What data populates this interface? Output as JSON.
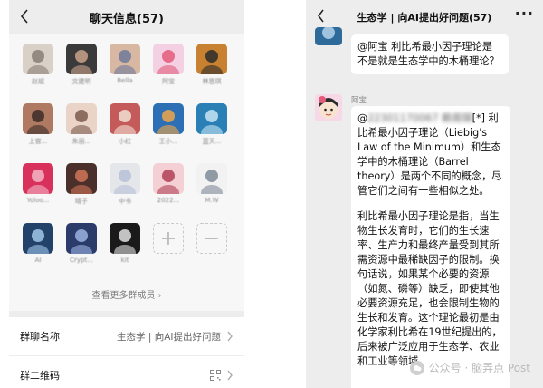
{
  "left": {
    "title": "聊天信息(57)",
    "members": [
      {
        "name": "赵斌",
        "color": "#d9d0c7",
        "accent": "#8a7f75"
      },
      {
        "name": "文建明",
        "color": "#3a3a3a",
        "accent": "#c9a38a"
      },
      {
        "name": "Bella",
        "color": "#d8b7a3",
        "accent": "#6c7a9a"
      },
      {
        "name": "阿宝",
        "color": "#f3d1e3",
        "accent": "#e35a7a"
      },
      {
        "name": "林思琪",
        "color": "#c88130",
        "accent": "#2b2b2b"
      },
      {
        "name": "上官...",
        "color": "#b07a62",
        "accent": "#3b2d28"
      },
      {
        "name": "朱丽...",
        "color": "#e9d4c7",
        "accent": "#7b5a4c"
      },
      {
        "name": "小红",
        "color": "#c55a5a",
        "accent": "#f1e0d4"
      },
      {
        "name": "王小...",
        "color": "#2d6fb4",
        "accent": "#f0a648"
      },
      {
        "name": "蓝天...",
        "color": "#2a7fb5",
        "accent": "#c7e4f5"
      },
      {
        "name": "Yoloo...",
        "color": "#d8315b",
        "accent": "#f3b5c6"
      },
      {
        "name": "晴子",
        "color": "#4b2f2a",
        "accent": "#d07658"
      },
      {
        "name": "中书",
        "color": "#e4e6ea",
        "accent": "#b7c0d6"
      },
      {
        "name": "2022...",
        "color": "#f4d0d5",
        "accent": "#b03f55"
      },
      {
        "name": "M.W",
        "color": "#f2f2f2",
        "accent": "#7f8a99"
      },
      {
        "name": "AI",
        "color": "#234269",
        "accent": "#9fc5ea"
      },
      {
        "name": "Crypt...",
        "color": "#2b3c6b",
        "accent": "#9bb3e0"
      },
      {
        "name": "kit",
        "color": "#1a1a1a",
        "accent": "#e0e0e0"
      }
    ],
    "add_symbol": "+",
    "remove_symbol": "−",
    "more_label": "查看更多群成员",
    "group_name_label": "群聊名称",
    "group_name_value": "生态学 | 向AI提出好问题",
    "qr_label": "群二维码"
  },
  "right": {
    "title": "生态学 | 向AI提出好问题(57)",
    "menu": "···",
    "question": "@阿宝  利比希最小因子理论是不是就是生态学中的木桶理论？",
    "sender_name": "阿宝",
    "reply_mention": "@",
    "reply_blurred": "22301170067 赖南锦",
    "reply_p1_rest": "[*] 利比希最小因子理论（Liebig's Law of the Minimum）和生态学中的木桶理论（Barrel theory）是两个不同的概念，尽管它们之间有一些相似之处。",
    "reply_p2": "利比希最小因子理论是指，当生物生长发育时，它们的生长速率、生产力和最终产量受到其所需资源中最稀缺因子的限制。换句话说，如果某个必要的资源（如氮、磷等）缺乏，即使其他必要资源充足，也会限制生物的生长和发育。这个理论最初是由化学家利比希在19世纪提出的，后来被广泛应用于生态学、农业和工业等领域。",
    "watermark": "公众号 · 脑弄点 Post"
  }
}
